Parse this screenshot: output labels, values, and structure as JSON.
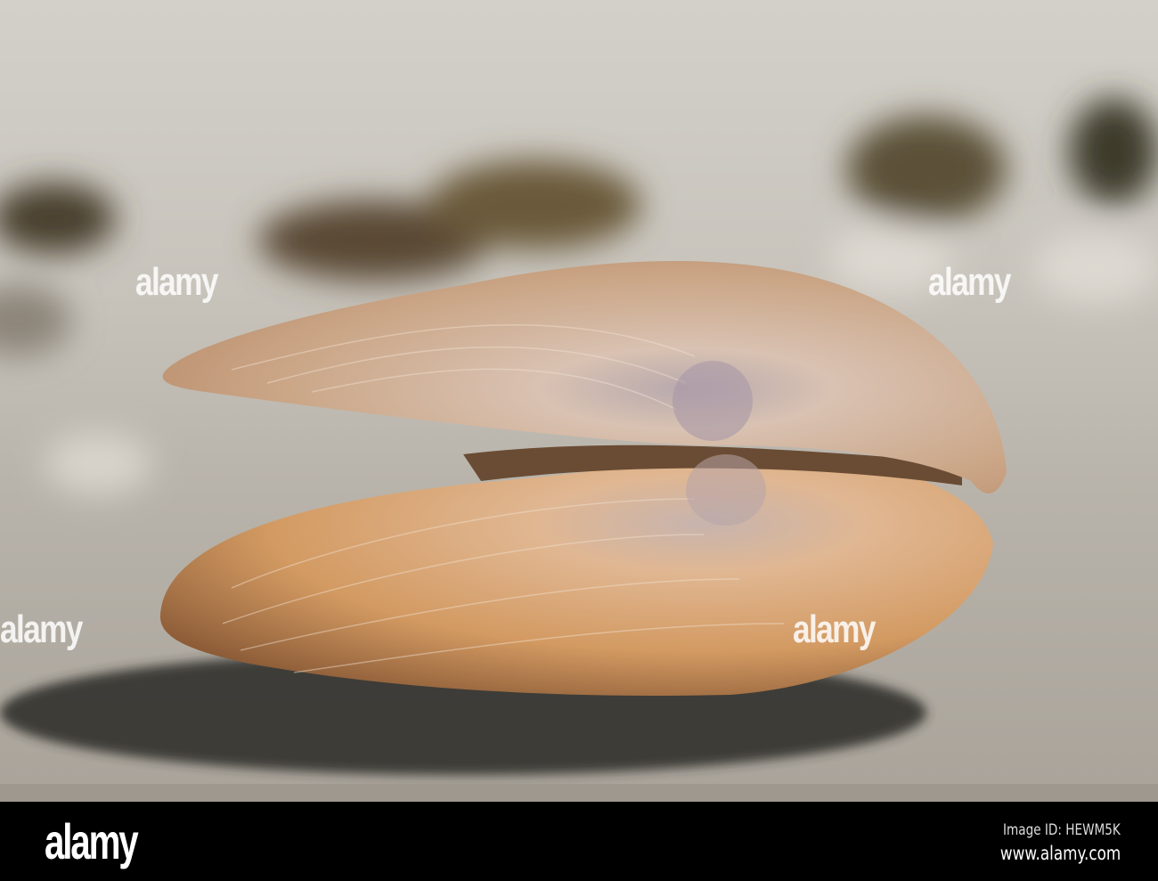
{
  "photo": {
    "subject": "clam-shell-on-sand",
    "colors": {
      "sand": "#b9b4ab",
      "shell": "#d7a77a",
      "shadow": "#2b2926"
    }
  },
  "watermark": {
    "text": "alamy"
  },
  "footer": {
    "logo": "alamy",
    "image_id": "Image ID: HEWM5K",
    "url": "www.alamy.com"
  }
}
